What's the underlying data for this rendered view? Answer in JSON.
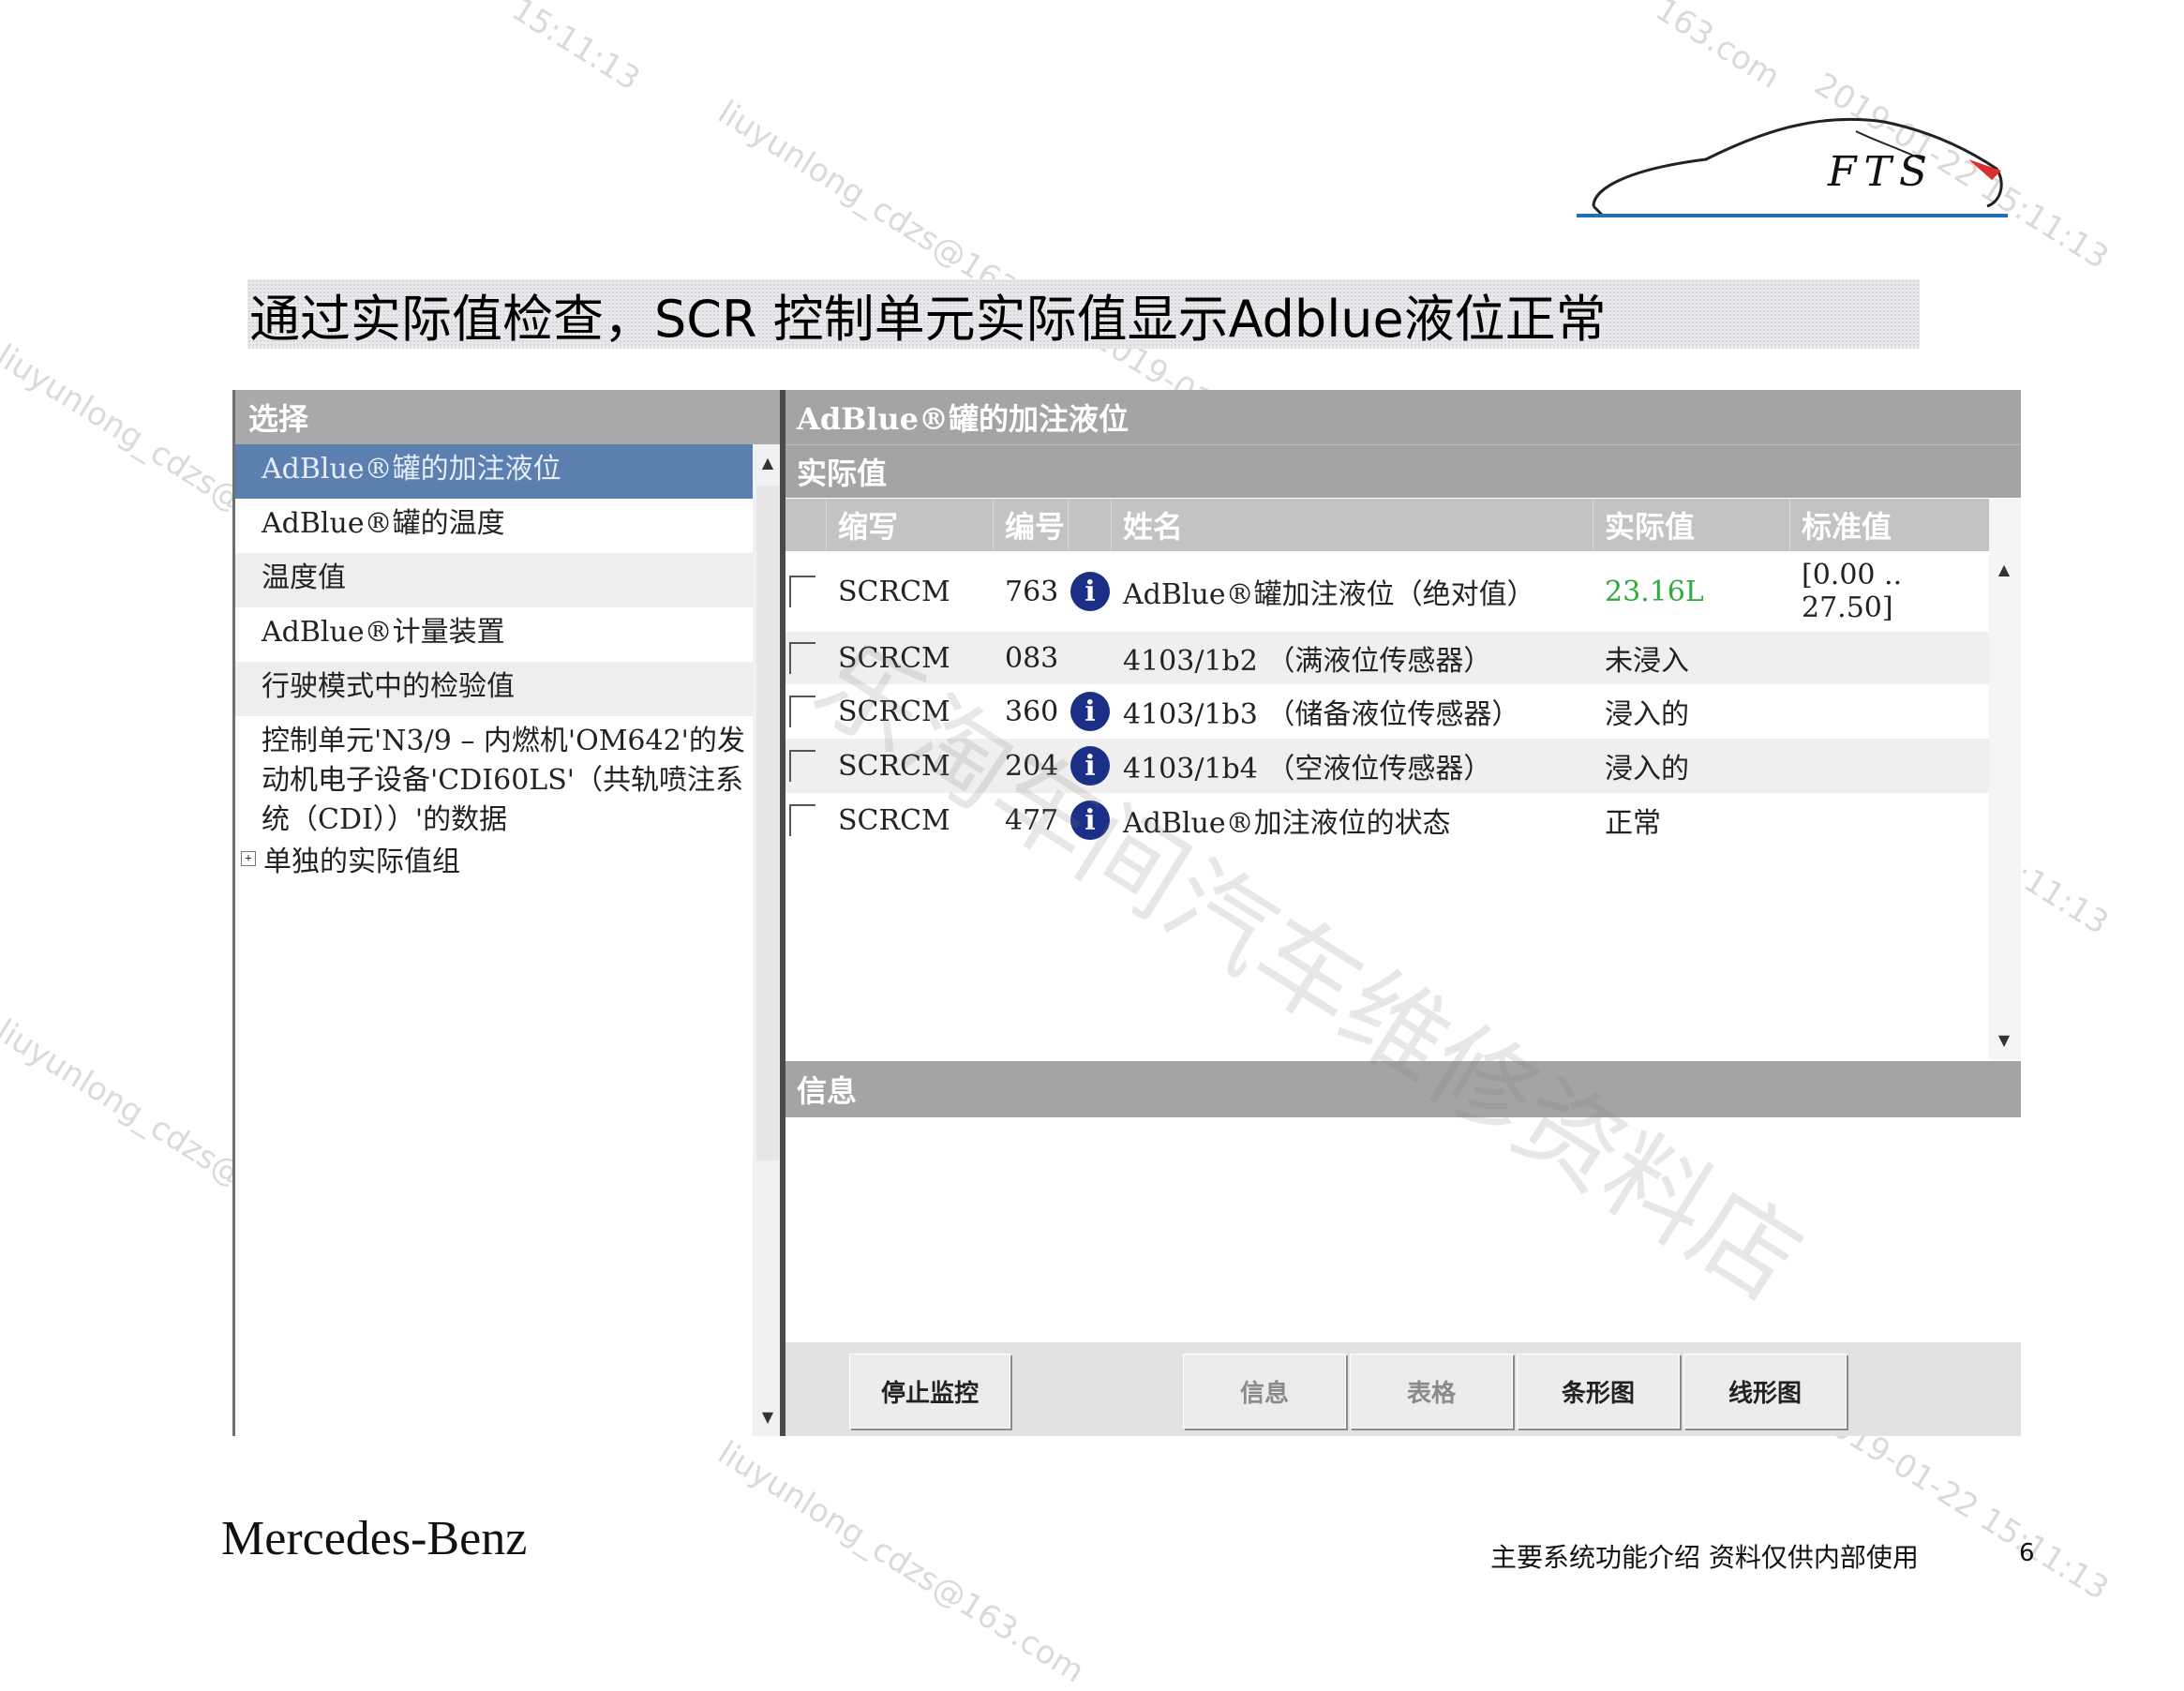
{
  "slide": {
    "title": "通过实际值检查，SCR 控制单元实际值显示Adblue液位正常",
    "logo_text": "FTS",
    "brand": "Mercedes-Benz",
    "footer_note": "主要系统功能介绍  资料仅供内部使用",
    "page_number": "6"
  },
  "left_panel": {
    "header": "选择",
    "items": [
      {
        "label": "AdBlue®罐的加注液位",
        "selected": true
      },
      {
        "label": "AdBlue®罐的温度"
      },
      {
        "label": "温度值"
      },
      {
        "label": "AdBlue®计量装置"
      },
      {
        "label": "行驶模式中的检验值"
      },
      {
        "label": "控制单元'N3/9 – 内燃机'OM642'的发动机电子设备'CDI60LS'（共轨喷注系统（CDI））'的数据"
      }
    ],
    "tree_item": {
      "expander": "+",
      "label": "单独的实际值组"
    }
  },
  "right_panel": {
    "header": "AdBlue®罐的加注液位",
    "subheader": "实际值",
    "columns": {
      "abbr": "缩写",
      "num": "编号",
      "name": "姓名",
      "value": "实际值",
      "standard": "标准值"
    },
    "rows": [
      {
        "abbr": "SCRCM",
        "num": "763",
        "info": true,
        "name": "AdBlue®罐加注液位（绝对值）",
        "value": "23.16L",
        "value_color": "#2eaa3a",
        "standard": "[0.00 .. 27.50]"
      },
      {
        "abbr": "SCRCM",
        "num": "083",
        "info": false,
        "name": "4103/1b2 （满液位传感器）",
        "value": "未浸入",
        "standard": ""
      },
      {
        "abbr": "SCRCM",
        "num": "360",
        "info": true,
        "name": "4103/1b3 （储备液位传感器）",
        "value": "浸入的",
        "standard": ""
      },
      {
        "abbr": "SCRCM",
        "num": "204",
        "info": true,
        "name": "4103/1b4 （空液位传感器）",
        "value": "浸入的",
        "standard": ""
      },
      {
        "abbr": "SCRCM",
        "num": "477",
        "info": true,
        "name": "AdBlue®加注液位的状态",
        "value": "正常",
        "standard": ""
      }
    ],
    "info_header": "信息",
    "buttons": [
      {
        "label": "停止监控",
        "enabled": true
      },
      {
        "label": "信息",
        "enabled": false
      },
      {
        "label": "表格",
        "enabled": false
      },
      {
        "label": "条形图",
        "enabled": true
      },
      {
        "label": "线形图",
        "enabled": true
      }
    ]
  },
  "watermarks": {
    "email": "liuyunlong_cdzs@163.com",
    "timestamp": "2019-01-22 15:11:13",
    "shop": "乐淘车间汽车维修资料店",
    "fragment_time": "15:11:13",
    "fragment_email": "163.com"
  },
  "colors": {
    "selection": "#5b7faf",
    "header_gray": "#a4a4a4",
    "info_icon": "#1b2f86",
    "logo_rule": "#1f6fb3",
    "value_ok": "#2eaa3a"
  }
}
